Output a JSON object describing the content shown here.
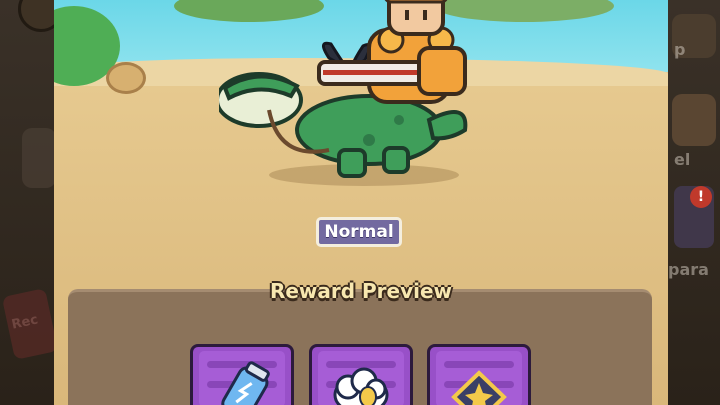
{
  "battle": {
    "difficulty_label": "Normal"
  },
  "rewards": {
    "title": "Reward Preview",
    "items": [
      {
        "icon": "energy-potion-icon"
      },
      {
        "icon": "cloud-egg-icon"
      },
      {
        "icon": "star-gem-icon"
      }
    ]
  },
  "side_menu": {
    "right_labels": [
      "p",
      "el",
      "para"
    ],
    "left_labels": [
      "Rec"
    ]
  },
  "colors": {
    "badge": "#736aa0",
    "card": "#9850c8",
    "panel": "#8b735a",
    "sand": "#e5c88f",
    "sea": "#6bd7e8"
  }
}
